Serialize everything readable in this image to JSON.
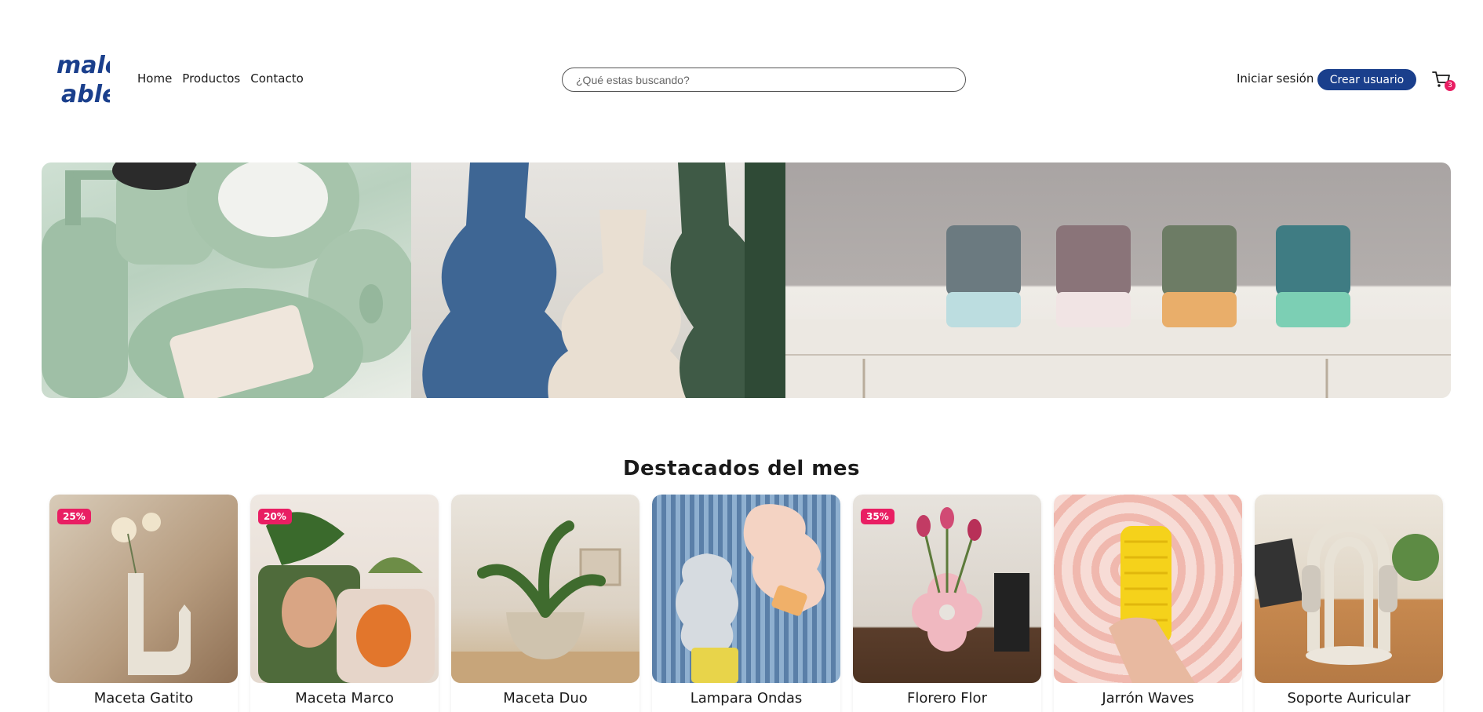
{
  "brand": {
    "logo_text_top": "male",
    "logo_text_bottom": "able",
    "color": "#1a3f8c"
  },
  "nav": {
    "items": [
      "Home",
      "Productos",
      "Contacto"
    ]
  },
  "search": {
    "placeholder": "¿Qué estas buscando?",
    "value": ""
  },
  "account": {
    "login_label": "Iniciar sesión",
    "create_label": "Crear usuario"
  },
  "cart": {
    "icon": "cart-icon",
    "count": "3"
  },
  "section": {
    "title": "Destacados del mes"
  },
  "colors": {
    "accent": "#1a3f8c",
    "badge": "#e91e63"
  },
  "products": [
    {
      "name": "Maceta Gatito",
      "discount": "25%"
    },
    {
      "name": "Maceta Marco",
      "discount": "20%"
    },
    {
      "name": "Maceta Duo",
      "discount": ""
    },
    {
      "name": "Lampara Ondas",
      "discount": ""
    },
    {
      "name": "Florero Flor",
      "discount": "35%"
    },
    {
      "name": "Jarrón Waves",
      "discount": ""
    },
    {
      "name": "Soporte Auricular",
      "discount": ""
    }
  ]
}
